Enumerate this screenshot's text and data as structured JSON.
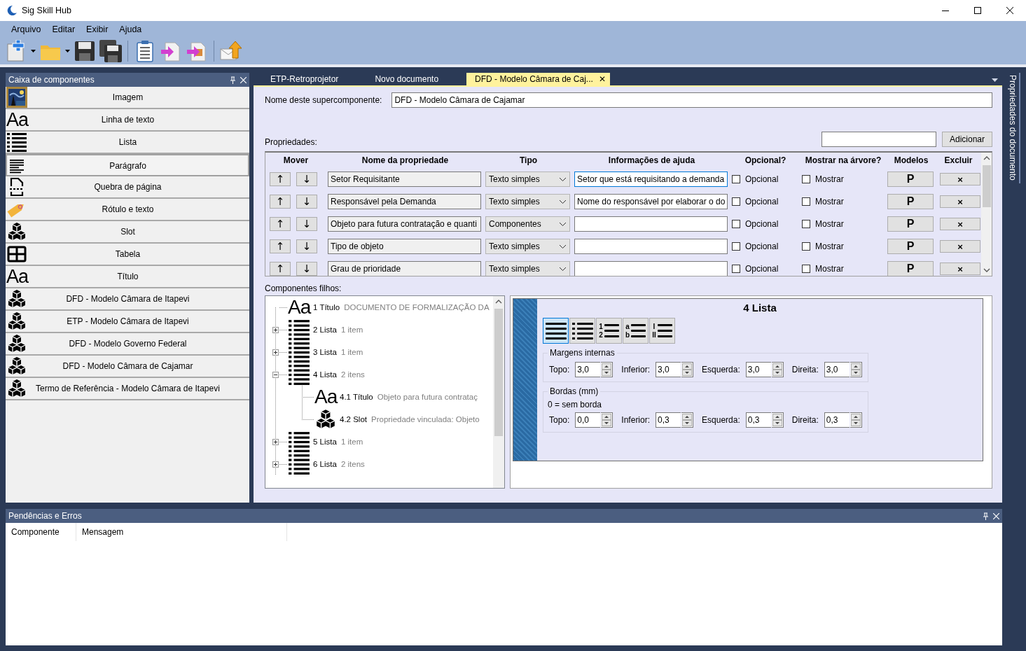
{
  "window": {
    "title": "Sig Skill Hub"
  },
  "menu": [
    {
      "label": "Arquivo"
    },
    {
      "label": "Editar"
    },
    {
      "label": "Exibir"
    },
    {
      "label": "Ajuda"
    }
  ],
  "toolbar": [
    {
      "kind": "new",
      "dropdown": true
    },
    {
      "kind": "open",
      "dropdown": true
    },
    {
      "kind": "save"
    },
    {
      "kind": "save_all"
    },
    {
      "kind": "separator"
    },
    {
      "kind": "checklist"
    },
    {
      "kind": "export"
    },
    {
      "kind": "export_image"
    },
    {
      "kind": "separator"
    },
    {
      "kind": "send"
    }
  ],
  "toolbox": {
    "title": "Caixa de componentes",
    "items": [
      {
        "label": "Imagem",
        "kind": "image",
        "selected": false
      },
      {
        "label": "Linha de texto",
        "kind": "text",
        "glyph": "Aa",
        "selected": false
      },
      {
        "label": "Lista",
        "kind": "list",
        "selected": false
      },
      {
        "label": "Parágrafo",
        "kind": "paragraph",
        "selected": true
      },
      {
        "label": "Quebra de página",
        "kind": "pagebreak",
        "selected": false
      },
      {
        "label": "Rótulo e texto",
        "kind": "tag",
        "selected": false
      },
      {
        "label": "Slot",
        "kind": "slot",
        "selected": false
      },
      {
        "label": "Tabela",
        "kind": "table",
        "selected": false
      },
      {
        "label": "Título",
        "kind": "text",
        "glyph": "Aa",
        "selected": false
      },
      {
        "label": "DFD - Modelo Câmara de Itapevi",
        "kind": "slot",
        "selected": false
      },
      {
        "label": "ETP - Modelo Câmara de Itapevi",
        "kind": "slot",
        "selected": false
      },
      {
        "label": "DFD - Modelo Governo Federal",
        "kind": "slot",
        "selected": false
      },
      {
        "label": "DFD - Modelo Câmara de Cajamar",
        "kind": "slot",
        "selected": false
      },
      {
        "label": "Termo de Referência - Modelo Câmara de Itapevi",
        "kind": "slot",
        "selected": false
      }
    ]
  },
  "tabs": [
    {
      "label": "ETP-Retroprojetor",
      "selected": false
    },
    {
      "label": "Novo documento",
      "selected": false
    },
    {
      "label": "DFD - Modelo Câmara de Caj...",
      "selected": true,
      "close": "✕"
    }
  ],
  "editor": {
    "name_label": "Nome deste supercomponente:",
    "name_value": "DFD - Modelo Câmara de Cajamar",
    "properties_label": "Propriedades:",
    "add_button": "Adicionar",
    "columns": [
      "Mover",
      "Nome da propriedade",
      "Tipo",
      "Informações de ajuda",
      "Opcional?",
      "Mostrar na árvore?",
      "Modelos",
      "Excluir"
    ],
    "rows": [
      {
        "up": "↑",
        "down": "↓",
        "name": "Setor Requisitante",
        "type": "Texto simples",
        "help": "Setor que está requisitando a demanda",
        "focused": true,
        "optional_label": "Opcional",
        "optional": false,
        "show_label": "Mostrar",
        "show": false,
        "model": "P",
        "delete": "×"
      },
      {
        "up": "↑",
        "down": "↓",
        "name": "Responsável pela Demanda",
        "type": "Texto simples",
        "help": "Nome do responsável por elaborar o do",
        "focused": false,
        "optional_label": "Opcional",
        "optional": false,
        "show_label": "Mostrar",
        "show": false,
        "model": "P",
        "delete": "×"
      },
      {
        "up": "↑",
        "down": "↓",
        "name": "Objeto para futura contratação e quanti",
        "type": "Componentes",
        "focused": false,
        "optional_label": "Opcional",
        "optional": false,
        "show_label": "Mostrar",
        "show": false,
        "model": "P",
        "delete": "×"
      },
      {
        "up": "↑",
        "down": "↓",
        "name": "Tipo de objeto",
        "type": "Texto simples",
        "focused": false,
        "optional_label": "Opcional",
        "optional": false,
        "show_label": "Mostrar",
        "show": false,
        "model": "P",
        "delete": "×"
      },
      {
        "up": "↑",
        "down": "↓",
        "name": "Grau de prioridade",
        "type": "Texto simples",
        "focused": false,
        "optional_label": "Opcional",
        "optional": false,
        "show_label": "Mostrar",
        "show": false,
        "model": "P",
        "delete": "×"
      }
    ],
    "children_label": "Componentes filhos:",
    "tree": [
      {
        "number": "1",
        "kind": "text",
        "glyph": "Aa",
        "label": "Título",
        "detail": "DOCUMENTO DE FORMALIZAÇÃO DA"
      },
      {
        "number": "2",
        "kind": "list",
        "label": "Lista",
        "detail": "1 item",
        "expanded": false
      },
      {
        "number": "3",
        "kind": "list",
        "label": "Lista",
        "detail": "1 item",
        "expanded": false
      },
      {
        "number": "4",
        "kind": "list",
        "label": "Lista",
        "detail": "2 itens",
        "expanded": true,
        "children": [
          {
            "number": "4.1",
            "kind": "text",
            "glyph": "Aa",
            "label": "Título",
            "detail": "Objeto para futura contrataç"
          },
          {
            "number": "4.2",
            "kind": "slot",
            "label": "Slot",
            "detail": "Propriedade vinculada: Objeto"
          }
        ]
      },
      {
        "number": "5",
        "kind": "list",
        "label": "Lista",
        "detail": "1 item",
        "expanded": false
      },
      {
        "number": "6",
        "kind": "list",
        "label": "Lista",
        "detail": "2 itens",
        "expanded": false
      }
    ],
    "detail": {
      "title": "4 Lista",
      "list_styles": [
        {
          "kind": "plain",
          "selected": true
        },
        {
          "kind": "bullets",
          "selected": false
        },
        {
          "kind": "marks",
          "marks": [
            "1",
            "2"
          ],
          "selected": false
        },
        {
          "kind": "marks",
          "marks": [
            "a",
            "b"
          ],
          "selected": false
        },
        {
          "kind": "marks",
          "marks": [
            "I",
            "II"
          ],
          "selected": false
        }
      ],
      "groups": [
        {
          "title": "Margens internas",
          "fields": [
            {
              "label": "Topo:",
              "value": "3,0"
            },
            {
              "label": "Inferior:",
              "value": "3,0"
            },
            {
              "label": "Esquerda:",
              "value": "3,0"
            },
            {
              "label": "Direita:",
              "value": "3,0"
            }
          ]
        },
        {
          "title": "Bordas (mm)",
          "note": "0 = sem borda",
          "fields": [
            {
              "label": "Topo:",
              "value": "0,0"
            },
            {
              "label": "Inferior:",
              "value": "0,3"
            },
            {
              "label": "Esquerda:",
              "value": "0,3"
            },
            {
              "label": "Direita:",
              "value": "0,3"
            }
          ]
        }
      ]
    }
  },
  "side_tab": {
    "label": "Propriedades do documento"
  },
  "errors_panel": {
    "title": "Pendências e Erros",
    "columns": [
      "Componente",
      "Mensagem"
    ]
  }
}
